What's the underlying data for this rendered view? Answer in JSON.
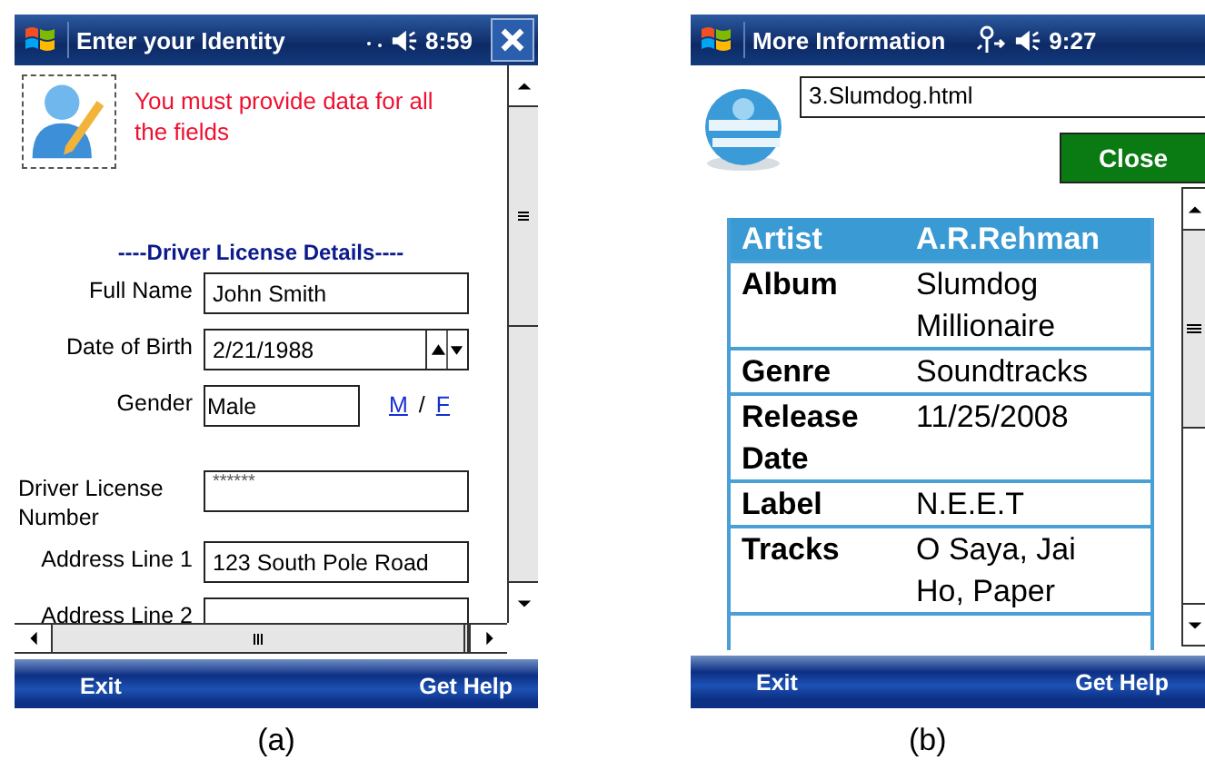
{
  "screen_a": {
    "title": "Enter your Identity",
    "time": "8:59",
    "message": "You must provide data for all the fields",
    "section_heading": "----Driver License Details----",
    "fields": [
      {
        "kind": "text",
        "label": "Full Name",
        "value": "John Smith"
      },
      {
        "kind": "date",
        "label": "Date of Birth",
        "value": "2/21/1988"
      },
      {
        "kind": "choice",
        "label": "Gender",
        "value": "Male",
        "links": [
          "M",
          "F"
        ],
        "separator": "/"
      },
      {
        "kind": "secret",
        "label": "Driver License Number",
        "value": "******"
      },
      {
        "kind": "text",
        "label": "Address Line 1",
        "value": "123 South Pole Road"
      },
      {
        "kind": "text",
        "label": "Address Line 2"
      }
    ],
    "menu": [
      "Exit",
      "Get Help"
    ],
    "caption": "(a)"
  },
  "screen_b": {
    "title": "More Information",
    "time": "9:27",
    "url": "3.Slumdog.html",
    "close_button": "Close",
    "table": [
      {
        "header": true,
        "label": "Artist",
        "value": "A.R.Rehman"
      },
      {
        "header": false,
        "label": "Album",
        "value": "Slumdog Millionaire"
      },
      {
        "header": false,
        "label": "Genre",
        "value": "Soundtracks"
      },
      {
        "header": false,
        "label": "Release Date",
        "value": "11/25/2008"
      },
      {
        "header": false,
        "label": "Label",
        "value": "N.E.E.T"
      },
      {
        "header": false,
        "label": "Tracks",
        "value": "O Saya, Jai Ho, Paper"
      }
    ],
    "menu": [
      "Exit",
      "Get Help"
    ],
    "caption": "(b)"
  }
}
